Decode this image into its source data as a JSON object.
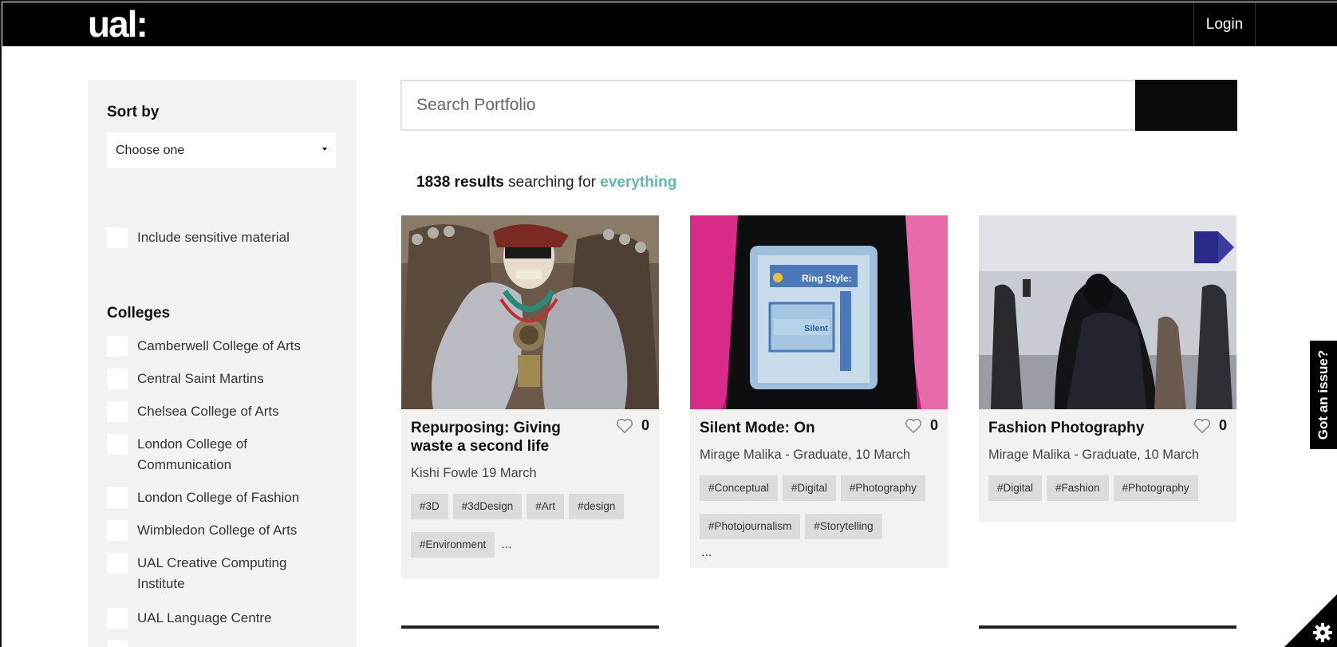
{
  "header": {
    "logo": "ual:",
    "login_label": "Login"
  },
  "sidebar": {
    "sort_heading": "Sort by",
    "sort_select_value": "Choose one",
    "sensitive_label": "Include sensitive material",
    "colleges_heading": "Colleges",
    "colleges": [
      "Camberwell College of Arts",
      "Central Saint Martins",
      "Chelsea College of Arts",
      "London College of Communication",
      "London College of Fashion",
      "Wimbledon College of Arts",
      "UAL Creative Computing Institute",
      "UAL Language Centre"
    ]
  },
  "search": {
    "placeholder": "Search Portfolio"
  },
  "results": {
    "count": "1838 results",
    "text": " searching for ",
    "term": "everything"
  },
  "cards": [
    {
      "title": "Repurposing: Giving waste a second life",
      "likes": "0",
      "meta": "Kishi Fowle 19 March",
      "tags": [
        "#3D",
        "#3dDesign",
        "#Art",
        "#design",
        "#Environment"
      ],
      "more": "..."
    },
    {
      "title": "Silent Mode: On",
      "likes": "0",
      "meta": "Mirage Malika - Graduate, 10 March",
      "tags": [
        "#Conceptual",
        "#Digital",
        "#Photography",
        "#Photojournalism",
        "#Storytelling"
      ],
      "more": "..."
    },
    {
      "title": "Fashion Photography",
      "likes": "0",
      "meta": "Mirage Malika - Graduate, 10 March",
      "tags": [
        "#Digital",
        "#Fashion",
        "#Photography"
      ],
      "more": ""
    }
  ],
  "screen_text": {
    "phone_ring_style": "Ring Style:",
    "phone_silent": "Silent"
  },
  "issue_tab": {
    "label": "Got an issue?"
  },
  "icons": {
    "like": "heart-outline-icon",
    "settings": "gear-icon"
  },
  "colors": {
    "accent": "#5dbcaa",
    "header_bg": "#000000",
    "sidebar_bg": "#f3f3f1",
    "tag_bg": "#dcdcda"
  }
}
